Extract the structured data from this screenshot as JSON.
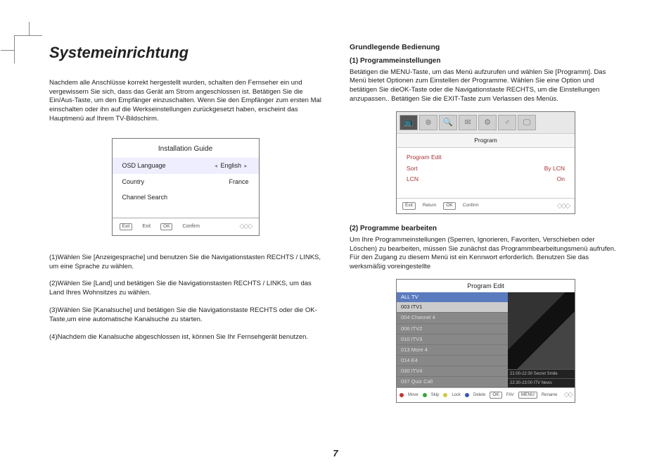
{
  "title": "Systemeinrichtung",
  "page_number": "7",
  "left": {
    "intro": "Nachdem alle Anschlüsse korrekt hergestellt wurden, schalten den Fernseher ein und vergewissern Sie sich, dass das Gerät am Strom angeschlossen ist. Betätigen Sie die Ein/Aus-Taste, um den Empfänger einzuschalten. Wenn Sie den Empfänger zum ersten Mal einschalten oder ihn auf die Werkseinstellungen zurückgesetzt haben, erscheint das Hauptmenü auf Ihrem TV-Bildschirm.",
    "osd": {
      "title": "Installation Guide",
      "rows": [
        {
          "label": "OSD Language",
          "value": "English",
          "arrows": true
        },
        {
          "label": "Country",
          "value": "France",
          "arrows": false
        },
        {
          "label": "Channel Search",
          "value": "",
          "arrows": false
        }
      ],
      "footer": {
        "exit_btn": "Exit",
        "exit_lbl": "Exit",
        "ok_btn": "OK",
        "ok_lbl": "Confirm"
      }
    },
    "steps": [
      "(1)Wählen Sie [Anzeigesprache] und benutzen Sie die Navigationstasten RECHTS / LINKS, um eine Sprache zu wählen.",
      "(2)Wählen Sie [Land] und betätigen Sie die Navigationstasten RECHTS / LINKS, um das Land Ihres Wohnsitzes zu wählen.",
      "(3)Wählen Sie [Kanalsuche] und betätigen Sie die Navigationstaste RECHTS oder die OK-Taste,um eine automatische Kanalsuche zu starten.",
      "(4)Nachdem die Kanalsuche abgeschlossen ist, können Sie Ihr Fernsehgerät benutzen."
    ]
  },
  "right": {
    "h2": "Grundlegende Bedienung",
    "s1_title": "(1) Programmeinstellungen",
    "s1_text": "Betätigen die MENU-Taste, um das Menü aufzurufen und wählen Sie [Programm]. Das Menü bietet Optionen zum Einstellen der Programme. Wählen Sie eine Option und betätigen Sie dieOK-Taste oder die Navigationstaste RECHTS, um die Einstellungen anzupassen.. Betätigen Sie die EXIT-Taste zum Verlassen des Menüs.",
    "menu": {
      "head": "Program",
      "icons": [
        "📺",
        "⊛",
        "🔍",
        "✉",
        "⚙",
        "♂",
        "🖵"
      ],
      "items": [
        {
          "label": "Program Edit",
          "value": ""
        },
        {
          "label": "Sort",
          "value": "By LCN"
        },
        {
          "label": "LCN",
          "value": "On"
        }
      ],
      "footer": {
        "exit_btn": "Exit",
        "exit_lbl": "Return",
        "ok_btn": "OK",
        "ok_lbl": "Confirm"
      }
    },
    "s2_title": "(2) Programme bearbeiten",
    "s2_text": "Um Ihre Programmeinstellungen (Sperren, Ignorieren, Favoriten, Verschieben oder Löschen) zu bearbeiten, müssen Sie zunächst das Programmbearbeitungsmenü aufrufen. Für den Zugang zu diesem Menü ist ein Kennwort erforderlich. Benutzen Sie das werksmäßig voreingestellte",
    "pe": {
      "title": "Program Edit",
      "tab": "ALL TV",
      "channels": [
        "003 ITV1",
        "004 Channel 4",
        "006 ITV2",
        "010 ITV3",
        "013 More 4",
        "014 E4",
        "030 ITV4",
        "037 Quiz Call"
      ],
      "epg": [
        "21:00-22:30  Secret Smile",
        "22:30-23:00  ITV News"
      ],
      "footer": [
        "Move",
        "Skip",
        "Lock",
        "Delete",
        "OK",
        "FAV",
        "Rename"
      ],
      "footer_btns": [
        "OK",
        "FAV",
        "MENU"
      ]
    }
  }
}
